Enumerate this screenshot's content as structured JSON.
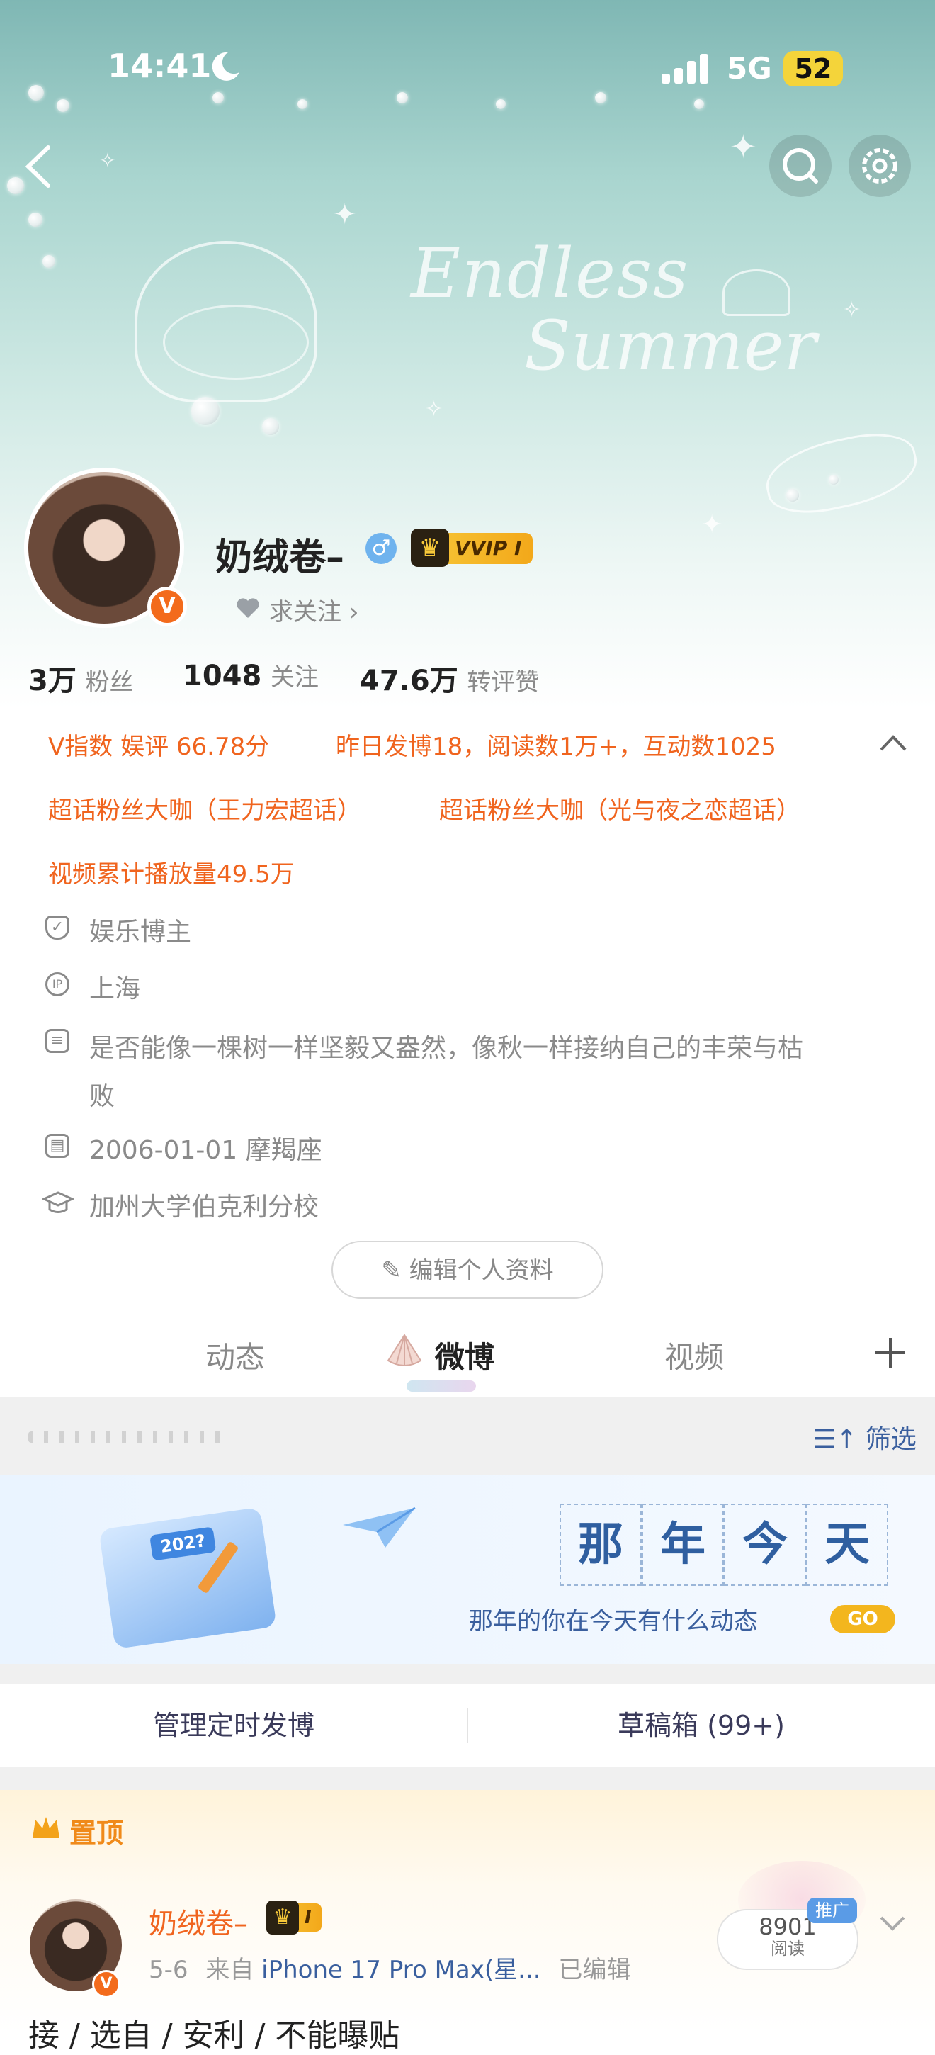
{
  "status_bar": {
    "time": "14:41",
    "network": "5G",
    "battery": "52"
  },
  "banner": {
    "script_line1": "Endless",
    "script_line2": "Summer"
  },
  "profile": {
    "nickname": "奶绒卷–",
    "vip_label": "VVIP I",
    "follow_prompt": "求关注",
    "stats": [
      {
        "value": "3万",
        "label": "粉丝"
      },
      {
        "value": "1048",
        "label": "关注"
      },
      {
        "value": "47.6万",
        "label": "转评赞"
      }
    ]
  },
  "badges": {
    "v_index": "V指数 娱评 66.78分",
    "yesterday": "昨日发博18，阅读数1万+，互动数1025",
    "super1": "超话粉丝大咖（王力宏超话）",
    "super2": "超话粉丝大咖（光与夜之恋超话）",
    "video_plays": "视频累计播放量49.5万"
  },
  "info": {
    "category": "娱乐博主",
    "ip": "上海",
    "bio_line1": "是否能像一棵树一样坚毅又盎然，像秋一样接纳自己的丰荣与枯",
    "bio_line2": "败",
    "birthday": "2006-01-01 摩羯座",
    "school": "加州大学伯克利分校"
  },
  "edit_profile_label": "编辑个人资料",
  "tabs": [
    "动态",
    "微博",
    "视频"
  ],
  "filter_label": "筛选",
  "on_this_day": {
    "chars": [
      "那",
      "年",
      "今",
      "天"
    ],
    "subtitle": "那年的你在今天有什么动态",
    "go": "GO",
    "calendar_year": "202?"
  },
  "manage": {
    "scheduled": "管理定时发博",
    "drafts": "草稿箱 (99+)"
  },
  "pinned": {
    "label": "置顶",
    "author": "奶绒卷–",
    "author_badge": "I",
    "date": "5-6",
    "source_prefix": "来自",
    "source": "iPhone 17 Pro Max(星...",
    "edited": "已编辑",
    "reads_value": "8901",
    "reads_label": "阅读",
    "promo": "推广",
    "preview_text": "接 / 选自 / 安利 / 不能曝贴"
  },
  "colors": {
    "accent_orange": "#f0641e",
    "battery_yellow": "#f4d43a",
    "go_yellow": "#f3b61e",
    "link_blue": "#2f5fa0"
  }
}
